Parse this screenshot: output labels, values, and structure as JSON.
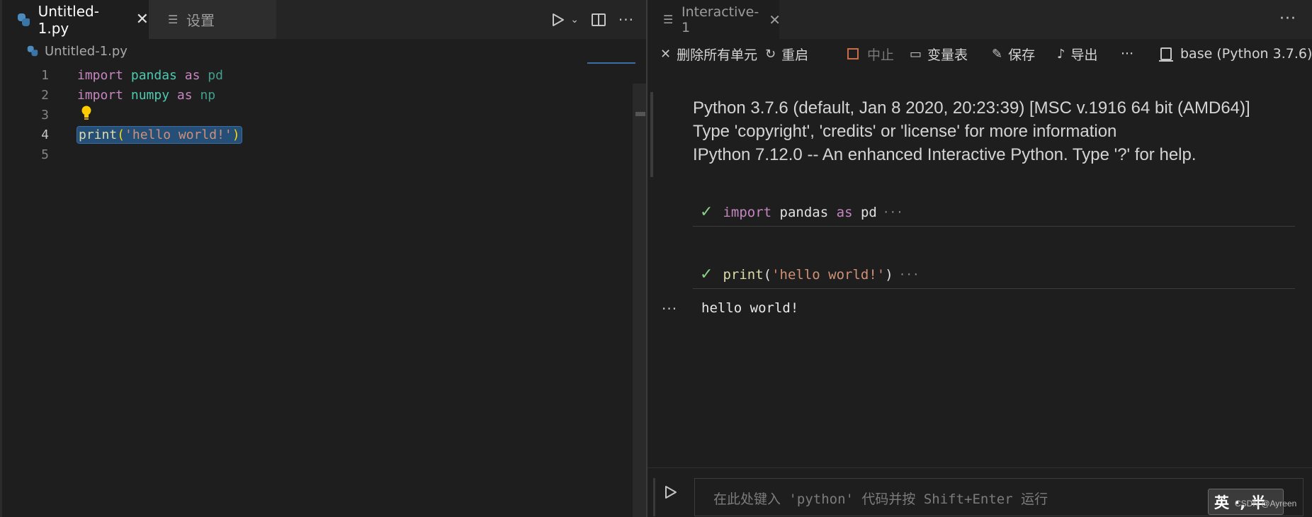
{
  "left_editor": {
    "tabs": [
      {
        "label": "Untitled-1.py"
      },
      {
        "label": "设置"
      }
    ],
    "breadcrumb": "Untitled-1.py",
    "line_numbers": [
      "1",
      "2",
      "3",
      "4",
      "5"
    ],
    "code": {
      "line1": {
        "kw1": "import",
        "mod": "pandas",
        "kw2": "as",
        "alias": "pd"
      },
      "line2": {
        "kw1": "import",
        "mod": "numpy",
        "kw2": "as",
        "alias": "np"
      },
      "line4": {
        "fn": "print",
        "open": "(",
        "str": "'hello world!'",
        "close": ")"
      }
    },
    "active_line": 4
  },
  "right_panel": {
    "tab_label": "Interactive-1",
    "toolbar": {
      "clear_all": "删除所有单元",
      "restart": "重启",
      "interrupt": "中止",
      "variables": "变量表",
      "save": "保存",
      "export": "导出",
      "kernel": "base (Python 3.7.6)"
    },
    "banner": [
      "Python 3.7.6 (default, Jan 8 2020, 20:23:39) [MSC v.1916 64 bit (AMD64)]",
      "Type 'copyright', 'credits' or 'license' for more information",
      "IPython 7.12.0 -- An enhanced Interactive Python. Type '?' for help."
    ],
    "cells": [
      {
        "kw1": "import",
        "mod": "pandas",
        "kw2": "as",
        "alias": "pd",
        "ellipsis": "···"
      },
      {
        "fn": "print",
        "open": "(",
        "str": "'hello world!'",
        "close": ")",
        "ellipsis": "···"
      }
    ],
    "output": "hello world!",
    "input_placeholder": "在此处键入 'python' 代码并按 Shift+Enter 运行"
  },
  "ime": {
    "label": "英 ·, 半",
    "watermark": "CSDN @Ayreen"
  },
  "colors": {
    "accent": "#264f78",
    "success": "#89d185",
    "background": "#1e1e1e",
    "tab_bar": "#252526"
  }
}
